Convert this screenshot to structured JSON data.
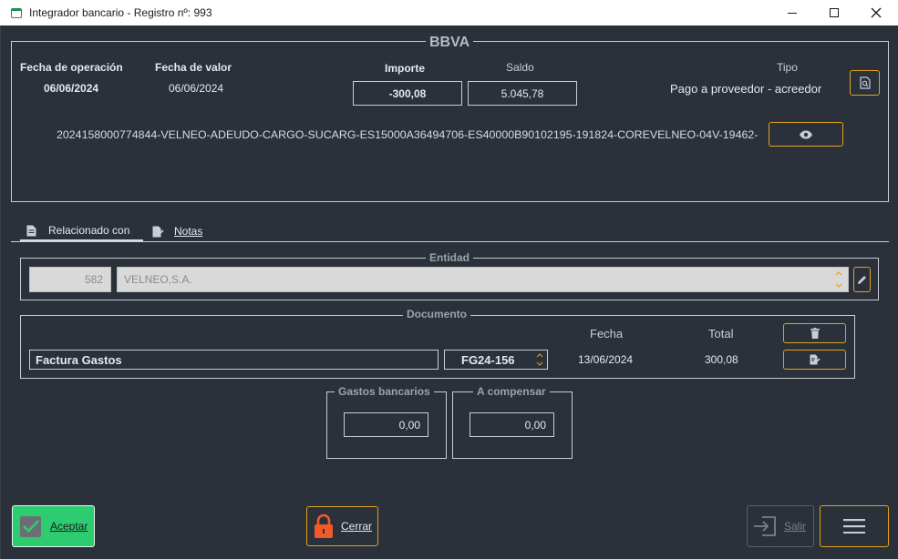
{
  "window": {
    "title": "Integrador bancario - Registro nº: 993"
  },
  "bank": {
    "name": "BBVA",
    "fecha_operacion_label": "Fecha de operación",
    "fecha_operacion": "06/06/2024",
    "fecha_valor_label": "Fecha de valor",
    "fecha_valor": "06/06/2024",
    "importe_label": "Importe",
    "importe": "-300,08",
    "saldo_label": "Saldo",
    "saldo": "5.045,78",
    "tipo_label": "Tipo",
    "tipo": "Pago a proveedor - acreedor",
    "concepto": "2024158000774844-VELNEO-ADEUDO-CARGO-SUCARG-ES15000A36494706-ES40000B90102195-191824-COREVELNEO-04V-19462-"
  },
  "tabs": [
    {
      "label": "Relacionado con",
      "icon": "document-icon",
      "active": true
    },
    {
      "label": "Notas",
      "icon": "notes-icon",
      "active": false
    }
  ],
  "entidad": {
    "legend": "Entidad",
    "code": "582",
    "name": "VELNEO,S.A."
  },
  "documento": {
    "legend": "Documento",
    "fecha_label": "Fecha",
    "total_label": "Total",
    "tipo": "Factura Gastos",
    "numero": "FG24-156",
    "fecha": "13/06/2024",
    "total": "300,08"
  },
  "gastos": {
    "legend": "Gastos bancarios",
    "value": "0,00"
  },
  "compensar": {
    "legend": "A compensar",
    "value": "0,00"
  },
  "footer": {
    "aceptar": "Aceptar",
    "cerrar": "Cerrar",
    "salir": "Salir"
  },
  "colors": {
    "accent": "#e0a21b",
    "accept": "#2ecc71",
    "lock": "#f05a28"
  }
}
